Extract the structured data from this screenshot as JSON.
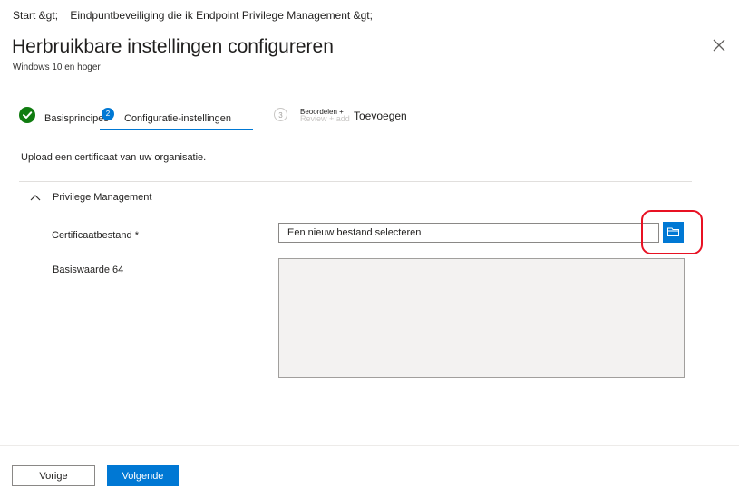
{
  "breadcrumb": {
    "home": "Start &gt;",
    "path": "Eindpuntbeveiliging die ik Endpoint Privilege Management &gt;"
  },
  "header": {
    "title": "Herbruikbare instellingen configureren",
    "subtitle": "Windows 10 en hoger"
  },
  "steps": [
    {
      "label": "Basisprincipes",
      "state": "completed"
    },
    {
      "number": "2",
      "label": "Configuratie-instellingen",
      "state": "active"
    },
    {
      "number": "3",
      "small_label": "Beoordelen +",
      "ghost_label": "Review + add",
      "label": "Toevoegen",
      "state": "pending"
    }
  ],
  "content": {
    "description": "Upload een certificaat van uw organisatie.",
    "section": {
      "title": "Privilege Management",
      "fields": {
        "certificate": {
          "label": "Certificaatbestand *",
          "value": "Een nieuw bestand selecteren"
        },
        "base64": {
          "label": "Basiswaarde 64",
          "value": ""
        }
      }
    }
  },
  "footer": {
    "prev_label": "Vorige",
    "next_label": "Volgende"
  },
  "icons": {
    "close": "close-icon",
    "check": "checkmark-icon",
    "collapse": "chevron-up-icon",
    "browse": "folder-icon"
  },
  "colors": {
    "accent": "#0078d4",
    "success": "#107c10",
    "highlight": "#e81123"
  }
}
